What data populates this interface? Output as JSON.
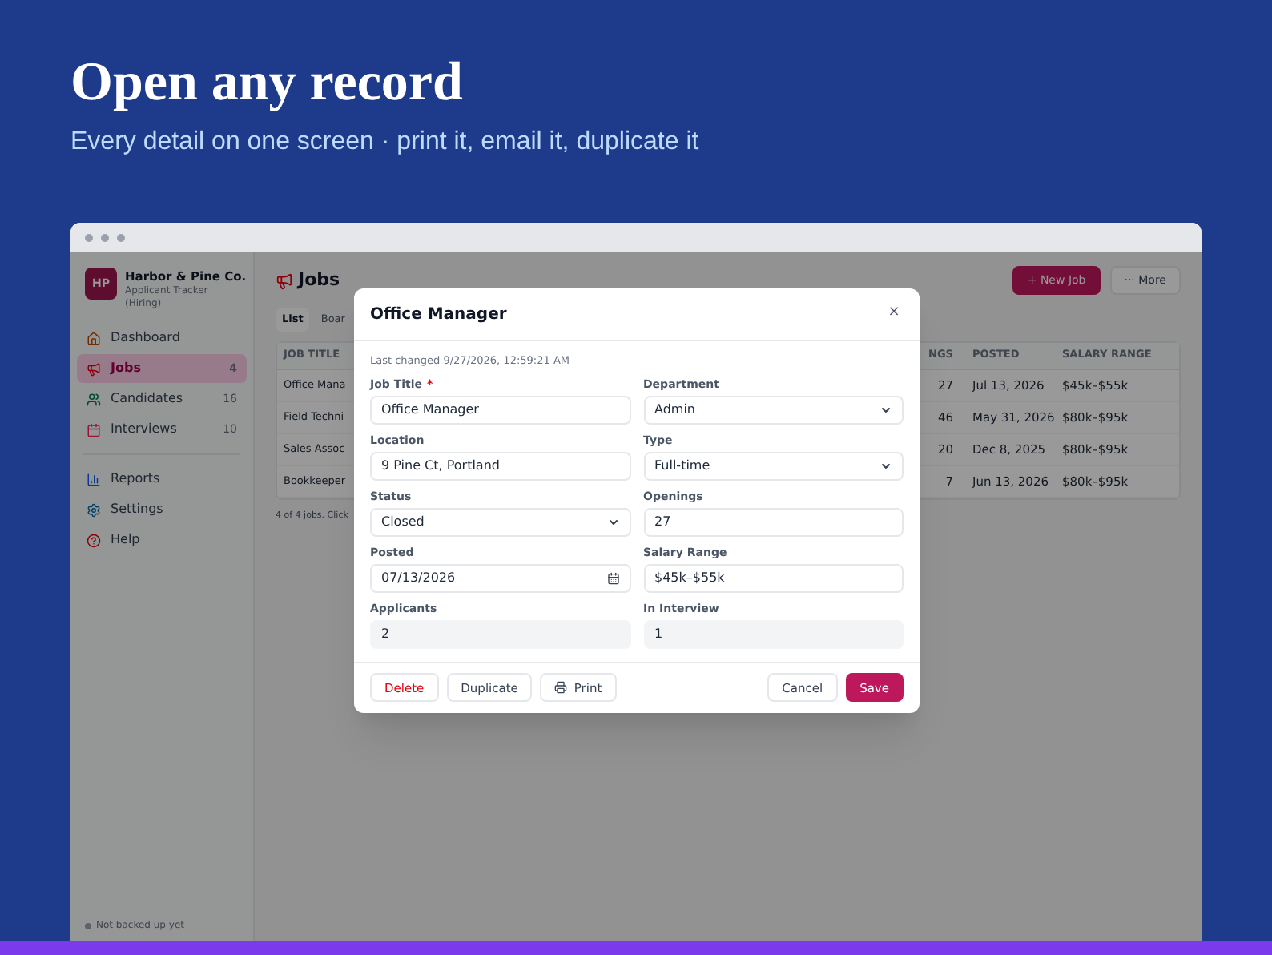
{
  "hero": {
    "title": "Open any record",
    "subtitle": "Every detail on one screen · print it, email it, duplicate it"
  },
  "sidebar": {
    "brand_initials": "HP",
    "brand_name": "Harbor & Pine Co.",
    "brand_sub": "Applicant Tracker (Hiring)",
    "items": [
      {
        "label": "Dashboard",
        "selected": false
      },
      {
        "label": "Jobs",
        "count": "4",
        "selected": true
      },
      {
        "label": "Candidates",
        "count": "16",
        "selected": false
      },
      {
        "label": "Interviews",
        "count": "10",
        "selected": false
      }
    ],
    "secondary_items": [
      {
        "label": "Reports",
        "selected": false
      },
      {
        "label": "Settings",
        "selected": false
      },
      {
        "label": "Help",
        "selected": false
      }
    ],
    "footer": "Not backed up yet"
  },
  "page": {
    "title": "Jobs",
    "actions": [
      {
        "label": "+ New Job",
        "kind": "primary"
      },
      {
        "label": "··· More",
        "kind": "default"
      }
    ],
    "tabs": [
      {
        "label": "List",
        "selected": true
      },
      {
        "label": "Boar",
        "selected": false
      }
    ],
    "table": {
      "columns": [
        "JOB TITLE",
        "NGS",
        "POSTED",
        "SALARY RANGE"
      ],
      "rows": [
        [
          "Office Mana",
          "27",
          "Jul 13, 2026",
          "$45k–$55k"
        ],
        [
          "Field Techni",
          "46",
          "May 31, 2026",
          "$80k–$95k"
        ],
        [
          "Sales Assoc",
          "20",
          "Dec 8, 2025",
          "$80k–$95k"
        ],
        [
          "Bookkeeper",
          "7",
          "Jun 13, 2026",
          "$80k–$95k"
        ]
      ]
    },
    "footer": "4 of 4 jobs. Click"
  },
  "dialog": {
    "title": "Office Manager",
    "close": "×",
    "last_changed": "Last changed 9/27/2026, 12:59:21 AM",
    "fields": [
      {
        "label": "Job Title",
        "required_mark": "*",
        "value": "Office Manager",
        "kind": "text"
      },
      {
        "label": "Department",
        "value": "Admin",
        "kind": "select"
      },
      {
        "label": "Location",
        "value": "9 Pine Ct, Portland",
        "kind": "text"
      },
      {
        "label": "Type",
        "value": "Full-time",
        "kind": "select"
      },
      {
        "label": "Status",
        "value": "Closed",
        "kind": "select"
      },
      {
        "label": "Openings",
        "value": "27",
        "kind": "text"
      },
      {
        "label": "Posted",
        "value": "07/13/2026",
        "kind": "date"
      },
      {
        "label": "Salary Range",
        "value": "$45k–$55k",
        "kind": "text"
      },
      {
        "label": "Applicants",
        "value": "2",
        "kind": "readonly"
      },
      {
        "label": "In Interview",
        "value": "1",
        "kind": "readonly"
      }
    ],
    "left_buttons": [
      {
        "label": "Delete",
        "kind": "danger"
      },
      {
        "label": "Duplicate",
        "kind": "default"
      },
      {
        "label": "Print",
        "kind": "print"
      }
    ],
    "right_buttons": [
      {
        "label": "Cancel",
        "kind": "default"
      },
      {
        "label": "Save",
        "kind": "primary"
      }
    ]
  }
}
